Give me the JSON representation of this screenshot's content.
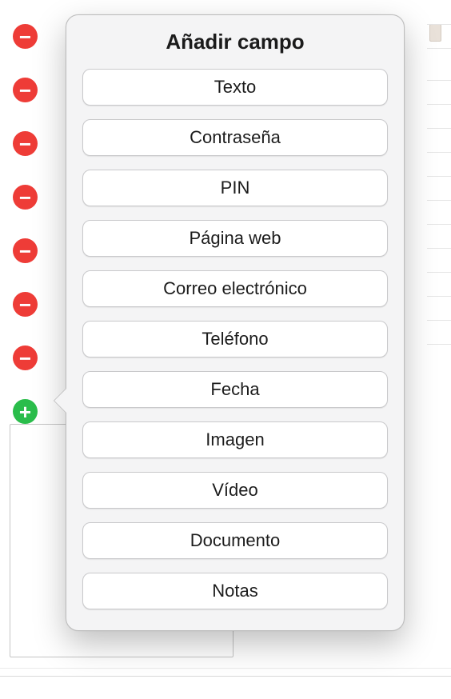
{
  "popover": {
    "title": "Añadir campo"
  },
  "field_types": {
    "items": [
      {
        "label": "Texto"
      },
      {
        "label": "Contraseña"
      },
      {
        "label": "PIN"
      },
      {
        "label": "Página web"
      },
      {
        "label": "Correo electrónico"
      },
      {
        "label": "Teléfono"
      },
      {
        "label": "Fecha"
      },
      {
        "label": "Imagen"
      },
      {
        "label": "Vídeo"
      },
      {
        "label": "Documento"
      },
      {
        "label": "Notas"
      }
    ]
  },
  "icons": {
    "minus_glyph": "−",
    "plus_glyph": "+"
  }
}
